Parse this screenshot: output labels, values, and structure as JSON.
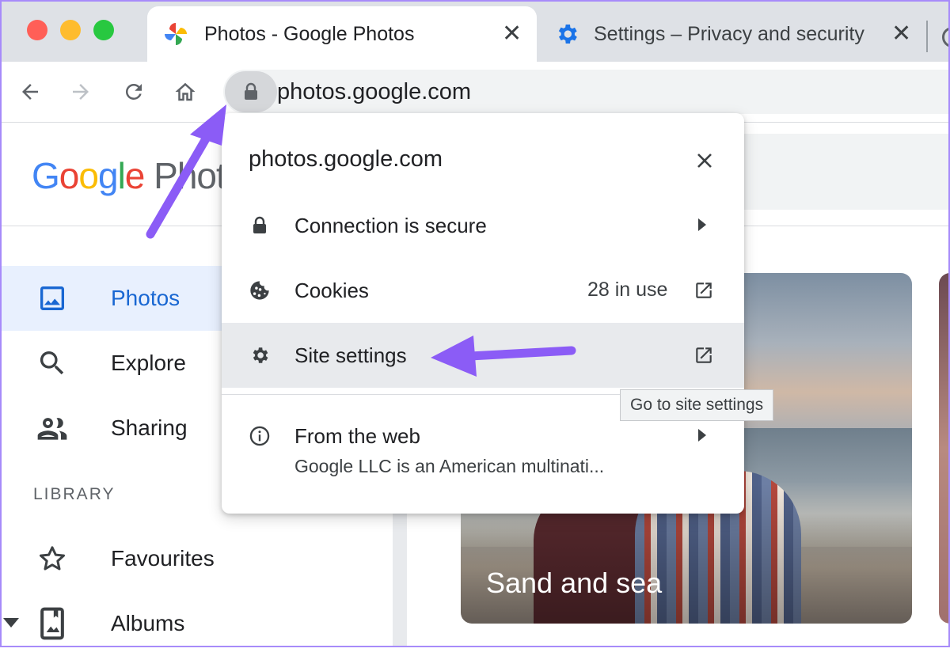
{
  "browser": {
    "tabs": [
      {
        "title": "Photos - Google Photos",
        "icon": "google-photos-pinwheel-icon",
        "active": true
      },
      {
        "title": "Settings – Privacy and security",
        "icon": "gear-icon",
        "active": false
      }
    ],
    "address": "photos.google.com"
  },
  "app": {
    "logo": {
      "G": "G",
      "o1": "o",
      "o2": "o",
      "g": "g",
      "l": "l",
      "e": "e",
      "rest": " Photo"
    },
    "nav": [
      {
        "label": "Photos",
        "icon": "photo-icon",
        "selected": true
      },
      {
        "label": "Explore",
        "icon": "search-icon",
        "selected": false
      },
      {
        "label": "Sharing",
        "icon": "people-icon",
        "selected": false
      }
    ],
    "library_label": "LIBRARY",
    "library": [
      {
        "label": "Favourites",
        "icon": "star-icon"
      },
      {
        "label": "Albums",
        "icon": "album-icon"
      }
    ],
    "memory_card": {
      "caption": "Sand and sea"
    }
  },
  "site_info": {
    "title": "photos.google.com",
    "rows": [
      {
        "label": "Connection is secure",
        "icon": "lock-icon"
      },
      {
        "label": "Cookies",
        "value": "28 in use",
        "icon": "cookie-icon"
      },
      {
        "label": "Site settings",
        "icon": "gear-icon",
        "highlighted": true
      },
      {
        "label": "From the web",
        "sub": "Google LLC is an American multinati...",
        "icon": "info-icon"
      }
    ],
    "tooltip": "Go to site settings"
  },
  "colors": {
    "accent": "#1967d2",
    "annotation_arrow": "#8b5cf6",
    "selected_bg": "#e8f0fe"
  }
}
